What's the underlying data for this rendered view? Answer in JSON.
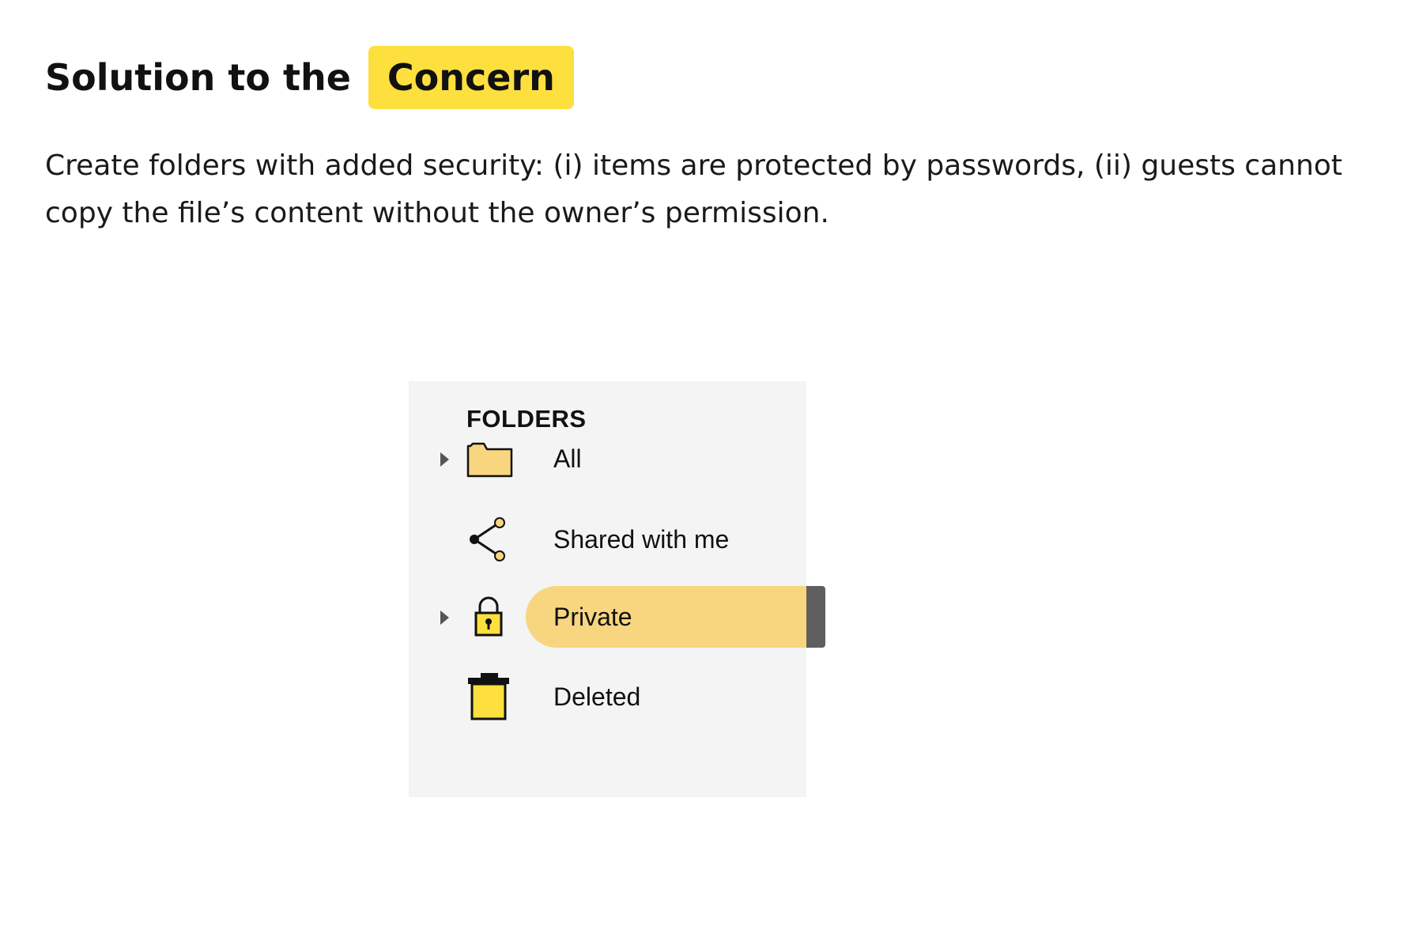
{
  "heading": {
    "text": "Solution to the",
    "highlight": "Concern",
    "highlight_color": "#fddf3e"
  },
  "description": "Create folders with added security: (i) items are protected by passwords, (ii) guests cannot copy the file’s content without the owner’s permission.",
  "folders_panel": {
    "title": "FOLDERS",
    "background": "#f4f4f4",
    "selected_color": "#f8d67f",
    "items": [
      {
        "label": "All",
        "icon": "folder-icon",
        "expandable": true,
        "selected": false
      },
      {
        "label": "Shared with me",
        "icon": "share-icon",
        "expandable": false,
        "selected": false
      },
      {
        "label": "Private",
        "icon": "lock-icon",
        "expandable": true,
        "selected": true
      },
      {
        "label": "Deleted",
        "icon": "trash-icon",
        "expandable": false,
        "selected": false
      }
    ]
  }
}
